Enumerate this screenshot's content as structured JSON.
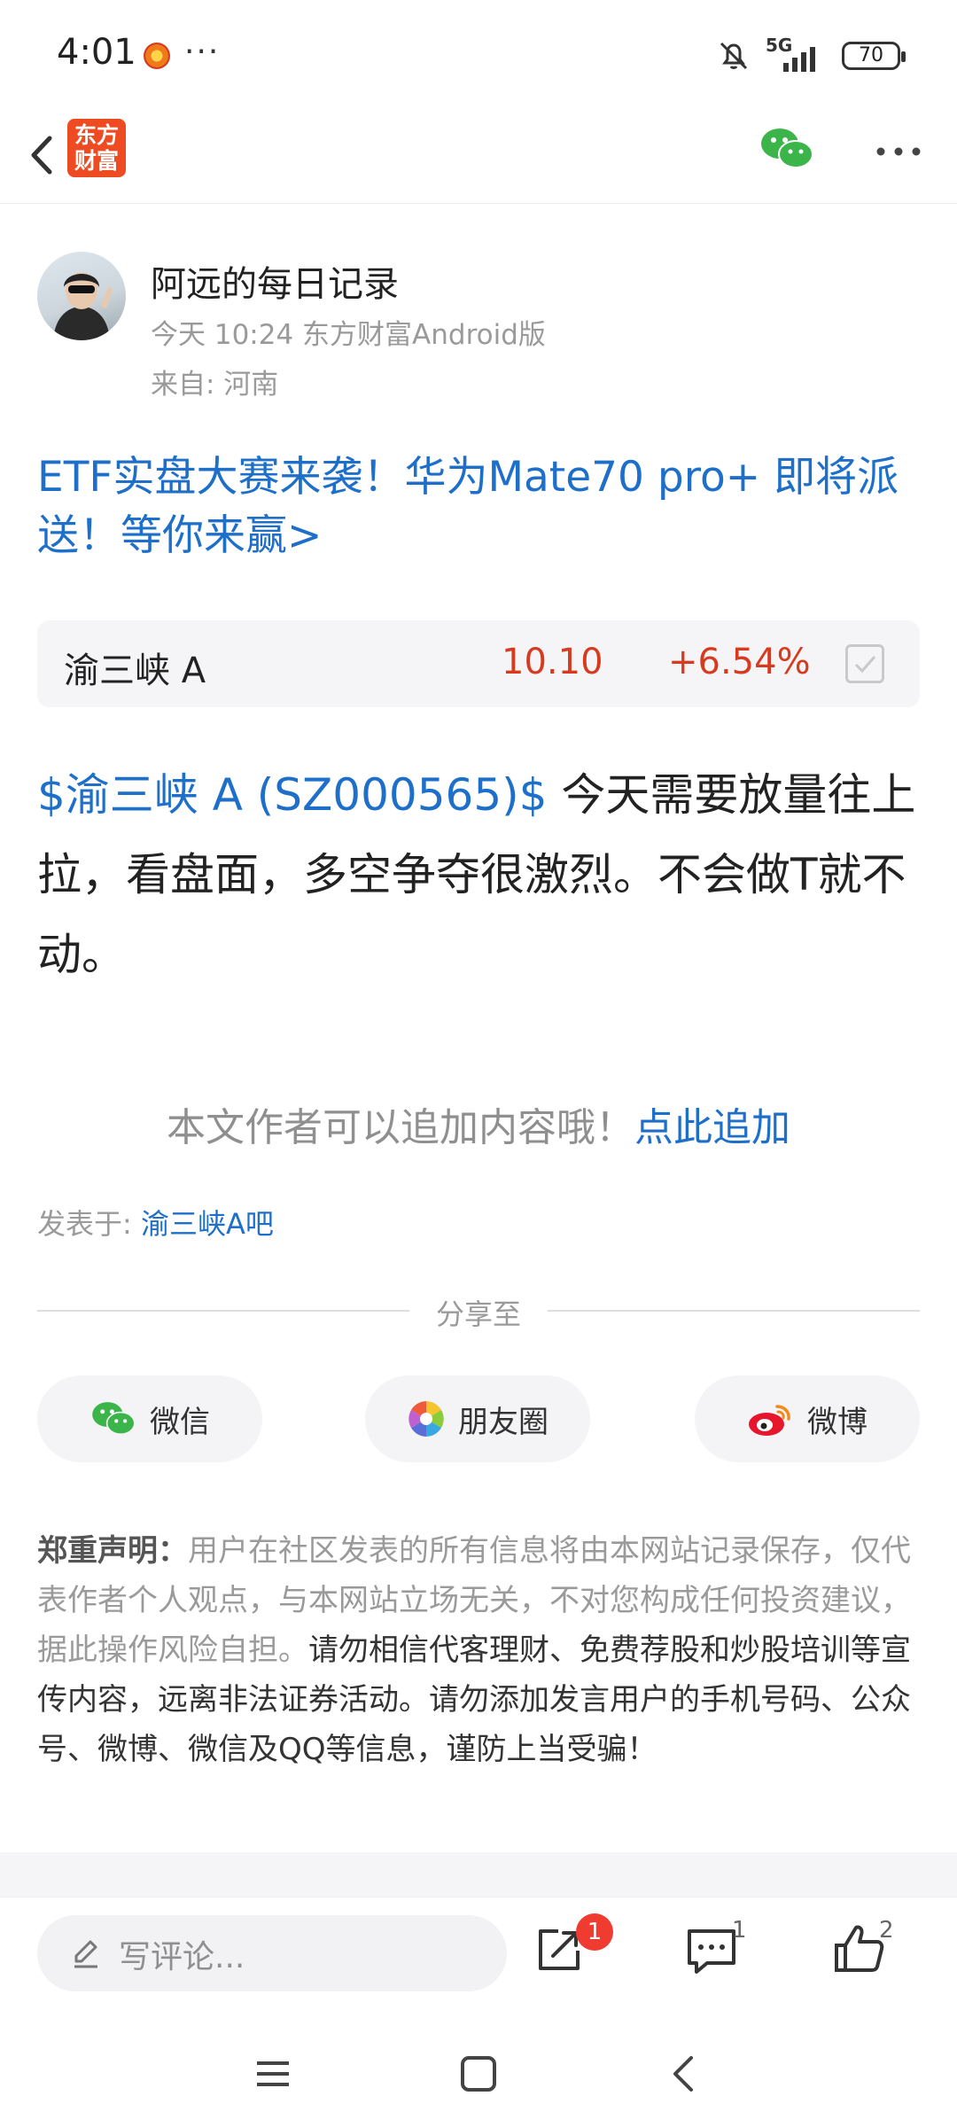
{
  "status_bar": {
    "time": "4:01",
    "more": "···",
    "network": "5G",
    "battery": "70"
  },
  "header": {
    "logo_line1": "东方",
    "logo_line2": "财富",
    "brand_color": "#ef4b22",
    "icons": [
      "back-icon",
      "wechat-icon",
      "more-icon"
    ]
  },
  "author": {
    "name": "阿远的每日记录",
    "meta": "今天 10:24 东方财富Android版",
    "from": "来自: 河南"
  },
  "promo": {
    "text": "ETF实盘大赛来袭！华为Mate70 pro+ 即将派送！等你来赢>"
  },
  "stock": {
    "name": "渝三峡 A",
    "price": "10.10",
    "change": "+6.54%",
    "up_color": "#d63b1f"
  },
  "post": {
    "stock_tag": "$渝三峡 A (SZ000565)$",
    "content": " 今天需要放量往上拉，看盘面，多空争夺很激烈。不会做T就不动。"
  },
  "append": {
    "text": "本文作者可以追加内容哦！",
    "link": "点此追加"
  },
  "posted_in": {
    "label": "发表于: ",
    "bar": "渝三峡A吧"
  },
  "share": {
    "title": "分享至",
    "wechat": "微信",
    "moments": "朋友圈",
    "weibo": "微博"
  },
  "disclaimer": {
    "title": "郑重声明：",
    "text": "用户在社区发表的所有信息将由本网站记录保存，仅代表作者个人观点，与本网站立场无关，不对您构成任何投资建议，据此操作风险自担。",
    "strong": "请勿相信代客理财、免费荐股和炒股培训等宣传内容，远离非法证券活动。请勿添加发言用户的手机号码、公众号、微博、微信及QQ等信息，谨防上当受骗！"
  },
  "action_bar": {
    "comment_placeholder": "写评论...",
    "share_badge": "1",
    "comment_count": "1",
    "like_count": "2"
  },
  "accent_link_color": "#1e6fc9"
}
